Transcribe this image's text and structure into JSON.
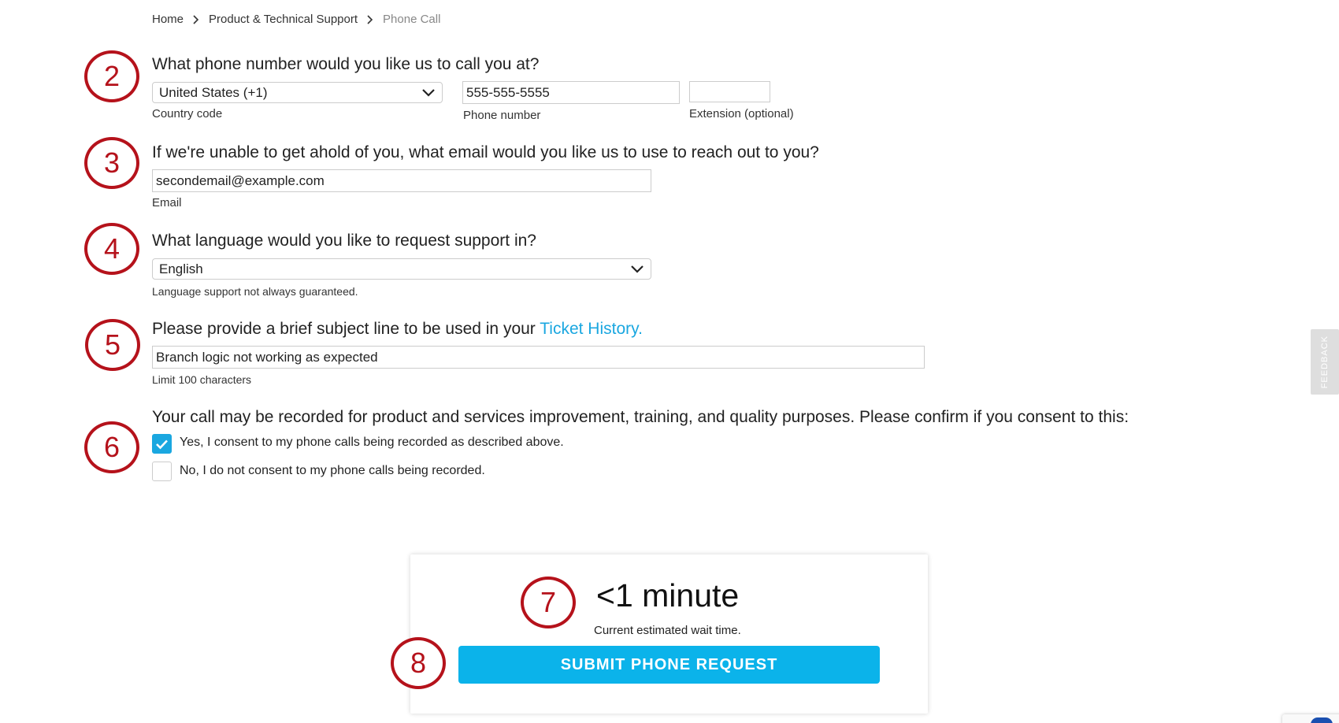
{
  "breadcrumb": {
    "items": [
      "Home",
      "Product & Technical Support"
    ],
    "current": "Phone Call"
  },
  "steps": {
    "phone": {
      "number": "2",
      "question": "What phone number would you like us to call you at?",
      "country_select_value": "United States (+1)",
      "country_label": "Country code",
      "phone_value": "555-555-5555",
      "phone_label": "Phone number",
      "extension_value": "",
      "extension_label": "Extension (optional)"
    },
    "email": {
      "number": "3",
      "question": "If we're unable to get ahold of you, what email would you like us to use to reach out to you?",
      "email_value": "secondemail@example.com",
      "email_label": "Email"
    },
    "language": {
      "number": "4",
      "question": "What language would you like to request support in?",
      "select_value": "English",
      "help": "Language support not always guaranteed."
    },
    "subject": {
      "number": "5",
      "question_prefix": "Please provide a brief subject line to be used in your ",
      "question_link": "Ticket History.",
      "subject_value": "Branch logic not working as expected",
      "help": "Limit 100 characters"
    },
    "consent": {
      "number": "6",
      "question": "Your call may be recorded for product and services improvement, training, and quality purposes. Please confirm if you consent to this:",
      "yes_label": "Yes, I consent to my phone calls being recorded as described above.",
      "yes_checked": true,
      "no_label": "No, I do not consent to my phone calls being recorded.",
      "no_checked": false
    },
    "wait": {
      "number": "7",
      "time": "<1 minute",
      "caption": "Current estimated wait time."
    },
    "submit": {
      "number": "8",
      "label": "SUBMIT PHONE REQUEST"
    }
  },
  "feedback_tab": {
    "label": "FEEDBACK"
  },
  "colors": {
    "accent": "#0bb3ea",
    "link": "#1aa7e0",
    "annotation_red": "#b5121b"
  }
}
